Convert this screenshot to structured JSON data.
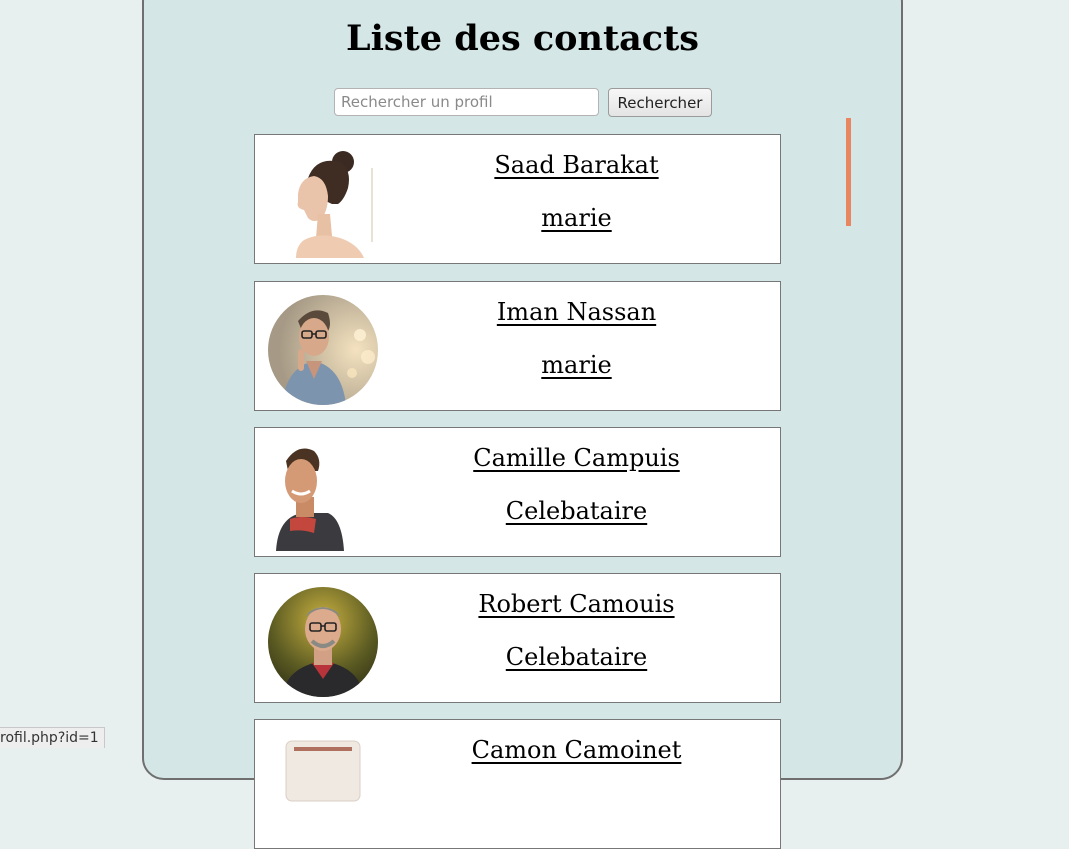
{
  "page": {
    "title": "Liste des contacts"
  },
  "search": {
    "placeholder": "Rechercher un profil",
    "value": "",
    "button_label": "Rechercher"
  },
  "contacts": [
    {
      "name": "Saad Barakat",
      "status": "marie",
      "avatar": "woman-profile-photo"
    },
    {
      "name": "Iman Nassan",
      "status": "marie",
      "avatar": "man-glasses-photo"
    },
    {
      "name": "Camille Campuis",
      "status": "Celebataire",
      "avatar": "smiling-man-photo"
    },
    {
      "name": "Robert Camouis",
      "status": "Celebataire",
      "avatar": "man-glasses-outdoor-photo"
    },
    {
      "name": "Camon Camoinet",
      "status": "",
      "avatar": "photo"
    }
  ],
  "status_bar": {
    "url": "rofil.php?id=1"
  },
  "colors": {
    "page_background": "#e8efef",
    "panel_background": "#d5e6e6",
    "scrollbar_accent": "#e8875f"
  }
}
